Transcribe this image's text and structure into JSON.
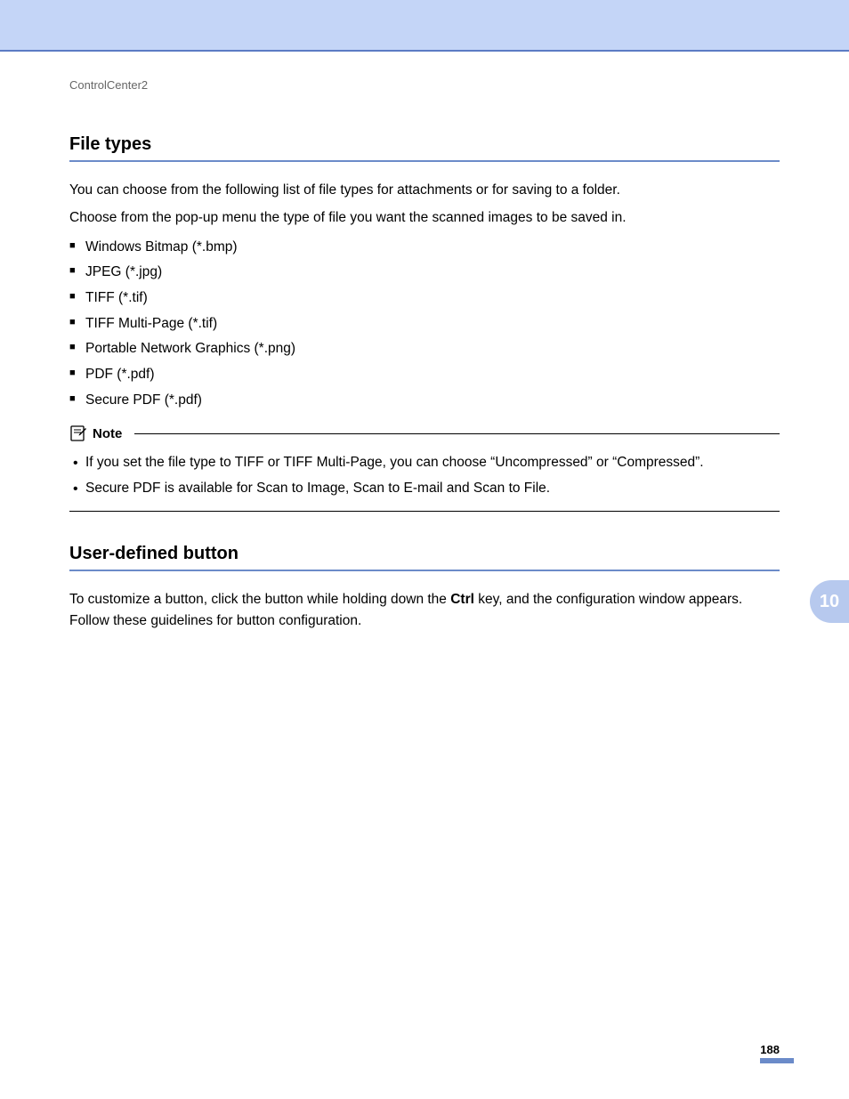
{
  "breadcrumb": "ControlCenter2",
  "section1": {
    "heading": "File types",
    "para1": "You can choose from the following list of file types for attachments or for saving to a folder.",
    "para2": "Choose from the pop-up menu the type of file you want the scanned images to be saved in.",
    "bullets": [
      "Windows Bitmap (*.bmp)",
      "JPEG (*.jpg)",
      "TIFF (*.tif)",
      "TIFF Multi-Page (*.tif)",
      "Portable Network Graphics (*.png)",
      "PDF (*.pdf)",
      "Secure PDF (*.pdf)"
    ]
  },
  "note": {
    "label": "Note",
    "items": [
      "If you set the file type to TIFF or TIFF Multi-Page, you can choose “Uncompressed” or “Compressed”.",
      "Secure PDF is available for Scan to Image, Scan to E-mail and Scan to File."
    ]
  },
  "section2": {
    "heading": "User-defined button",
    "para_prefix": "To customize a button, click the button while holding down the ",
    "para_bold": "Ctrl",
    "para_suffix": " key, and the configuration window appears. Follow these guidelines for button configuration."
  },
  "sideTab": "10",
  "pageNumber": "188"
}
